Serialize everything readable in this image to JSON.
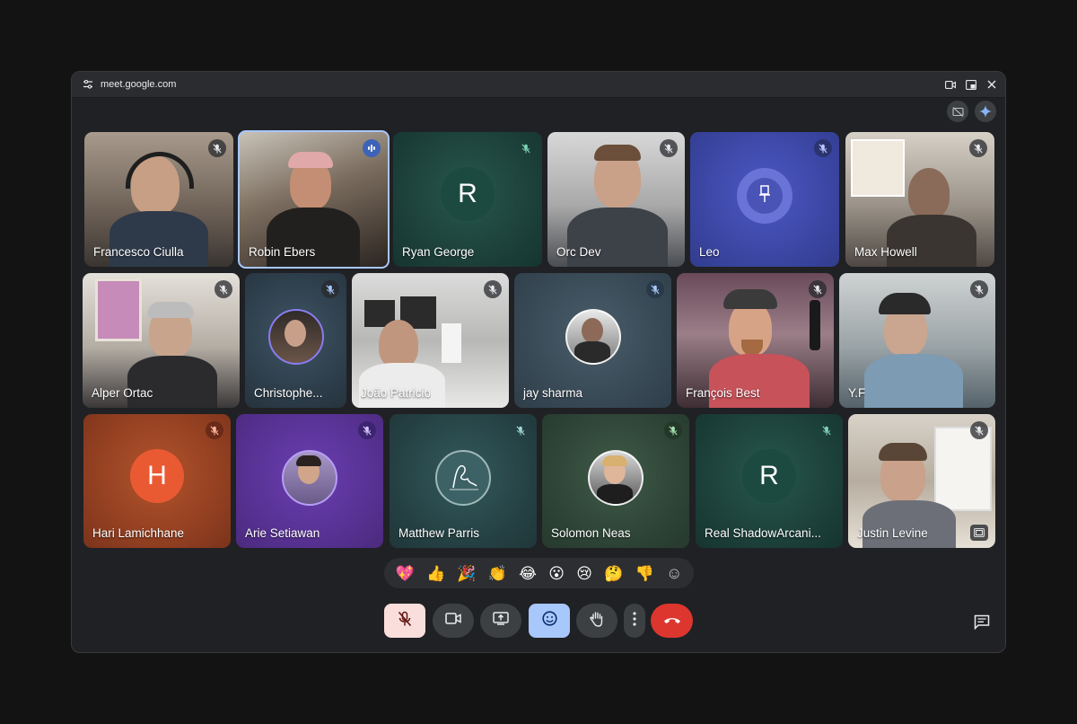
{
  "browser": {
    "url": "meet.google.com",
    "icons": [
      "site-settings-icon",
      "camera-icon",
      "pop-out-icon",
      "close-icon"
    ]
  },
  "top_icons": [
    "hide-self-view-icon",
    "gemini-sparkle-icon"
  ],
  "participants": [
    {
      "name": "Francesco Ciulla",
      "mic": "muted",
      "kind": "video"
    },
    {
      "name": "Robin Ebers",
      "mic": "speaking",
      "kind": "video"
    },
    {
      "name": "Ryan George",
      "mic": "muted",
      "kind": "letter",
      "letter": "R"
    },
    {
      "name": "Orc Dev",
      "mic": "muted",
      "kind": "video"
    },
    {
      "name": "Leo",
      "mic": "muted",
      "kind": "pinned"
    },
    {
      "name": "Max Howell",
      "mic": "muted",
      "kind": "video"
    },
    {
      "name": "Alper Ortac",
      "mic": "muted",
      "kind": "video"
    },
    {
      "name": "Christophe...",
      "mic": "muted",
      "kind": "photo"
    },
    {
      "name": "João Patricio",
      "mic": "muted",
      "kind": "video"
    },
    {
      "name": "jay sharma",
      "mic": "muted",
      "kind": "photo"
    },
    {
      "name": "François Best",
      "mic": "muted",
      "kind": "video"
    },
    {
      "name": "Y.F",
      "mic": "muted",
      "kind": "video"
    },
    {
      "name": "Hari Lamichhane",
      "mic": "muted",
      "kind": "letter",
      "letter": "H"
    },
    {
      "name": "Arie Setiawan",
      "mic": "muted",
      "kind": "photo"
    },
    {
      "name": "Matthew Parris",
      "mic": "muted",
      "kind": "photo"
    },
    {
      "name": "Solomon Neas",
      "mic": "muted",
      "kind": "photo"
    },
    {
      "name": "Real ShadowArcani...",
      "mic": "muted",
      "kind": "letter",
      "letter": "R"
    },
    {
      "name": "Justin Levine",
      "mic": "muted",
      "kind": "video"
    }
  ],
  "reactions": [
    "💖",
    "👍",
    "🎉",
    "👏",
    "😂",
    "😮",
    "😢",
    "🤔",
    "👎",
    "☺"
  ],
  "controls": [
    "mic-muted-icon",
    "camera-icon",
    "present-screen-icon",
    "emoji-icon",
    "raise-hand-icon",
    "more-options-icon",
    "leave-call-icon"
  ],
  "colors": {
    "accent": "#a8c7fa",
    "mic_off_bg": "#f9dedc",
    "emoji_active": "#a8c7fa",
    "hangup": "#dc362e"
  }
}
